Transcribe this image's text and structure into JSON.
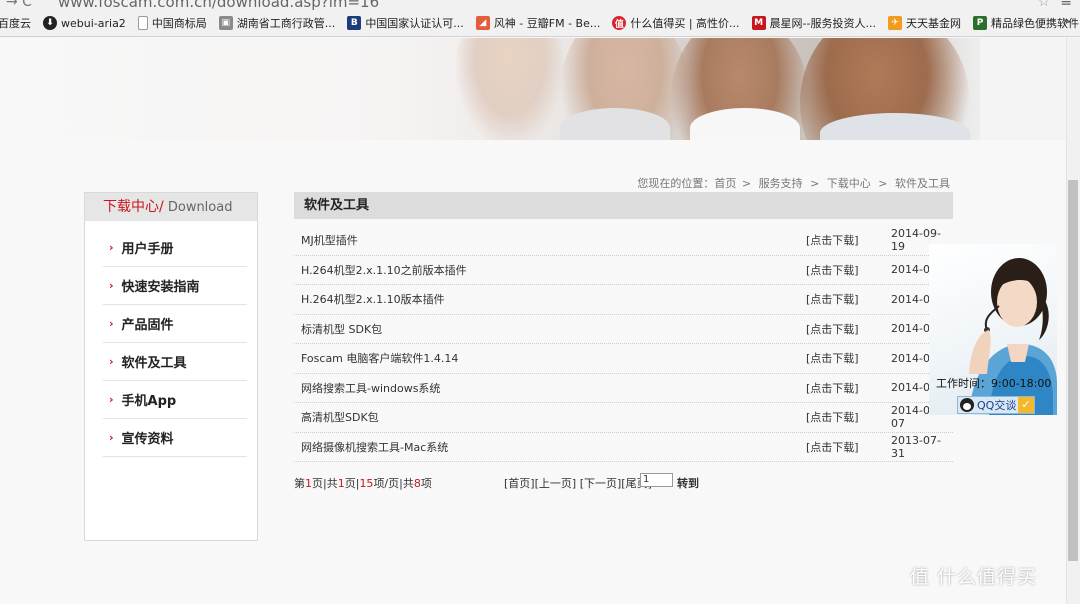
{
  "browser": {
    "url": "www.foscam.com.cn/download.asp?lm=16",
    "bookmarks": [
      {
        "label": "百度云",
        "icon": "cloud-icon",
        "color": "#3385ff"
      },
      {
        "label": "webui-aria2",
        "icon": "download-arrow-icon",
        "color": "#222222"
      },
      {
        "label": "中国商标局",
        "icon": "page-icon",
        "color": "#999999"
      },
      {
        "label": "湖南省工商行政管...",
        "icon": "image-icon",
        "color": "#6b6b6b"
      },
      {
        "label": "中国国家认证认可...",
        "icon": "cnca-icon",
        "color": "#1d3b7a"
      },
      {
        "label": "风神 - 豆瓣FM - Be...",
        "icon": "douban-icon",
        "color": "#e35d3c"
      },
      {
        "label": "什么值得买 | 高性价...",
        "icon": "smzdm-icon",
        "color": "#d9252c"
      },
      {
        "label": "晨星网--服务投资人...",
        "icon": "morningstar-icon",
        "color": "#c8161d"
      },
      {
        "label": "天天基金网",
        "icon": "fund-icon",
        "color": "#f39b1d"
      },
      {
        "label": "精品绿色便携软件",
        "icon": "p-icon",
        "color": "#2c6e2c"
      }
    ],
    "more_label": "»"
  },
  "breadcrumb": {
    "prefix": "您现在的位置：",
    "items": [
      "首页",
      "服务支持",
      "下载中心",
      "软件及工具"
    ],
    "separator": ">"
  },
  "sidebar": {
    "title_cn": "下载中心/",
    "title_en": " Download",
    "items": [
      {
        "label": "用户手册"
      },
      {
        "label": "快速安装指南"
      },
      {
        "label": "产品固件"
      },
      {
        "label": "软件及工具"
      },
      {
        "label": "手机App"
      },
      {
        "label": "宣传资料"
      }
    ]
  },
  "content": {
    "section_title": "软件及工具",
    "download_label": "[点击下载]",
    "rows": [
      {
        "title": "MJ机型插件",
        "date": "2014-09-19"
      },
      {
        "title": "H.264机型2.x.1.10之前版本插件",
        "date": "2014-09"
      },
      {
        "title": "H.264机型2.x.1.10版本插件",
        "date": "2014-09"
      },
      {
        "title": "标清机型 SDK包",
        "date": "2014-08"
      },
      {
        "title": "Foscam 电脑客户端软件1.4.14",
        "date": "2014-08"
      },
      {
        "title": "网络搜索工具-windows系统",
        "date": "2014-08"
      },
      {
        "title": "高清机型SDK包",
        "date": "2014-02-07"
      },
      {
        "title": "网络摄像机搜索工具-Mac系统",
        "date": "2013-07-31"
      }
    ]
  },
  "pager": {
    "t1": "第",
    "page": "1",
    "t2": "页|共",
    "pages": "1",
    "t3": "页|",
    "per_page": "15",
    "t4": "项/页|共",
    "total": "8",
    "t5": "项",
    "first": "[首页]",
    "prev": "[上一页]",
    "next": "[下一页]",
    "last": "[尾页]",
    "goto_value": "1",
    "goto_label": "转到"
  },
  "customer_service": {
    "hours": "工作时间：9:00-18:00",
    "qq_label": "QQ交谈"
  },
  "watermark": "值 什么值得买",
  "colors": {
    "accent_red": "#c8161d",
    "header_gray": "#dcdcdc"
  }
}
